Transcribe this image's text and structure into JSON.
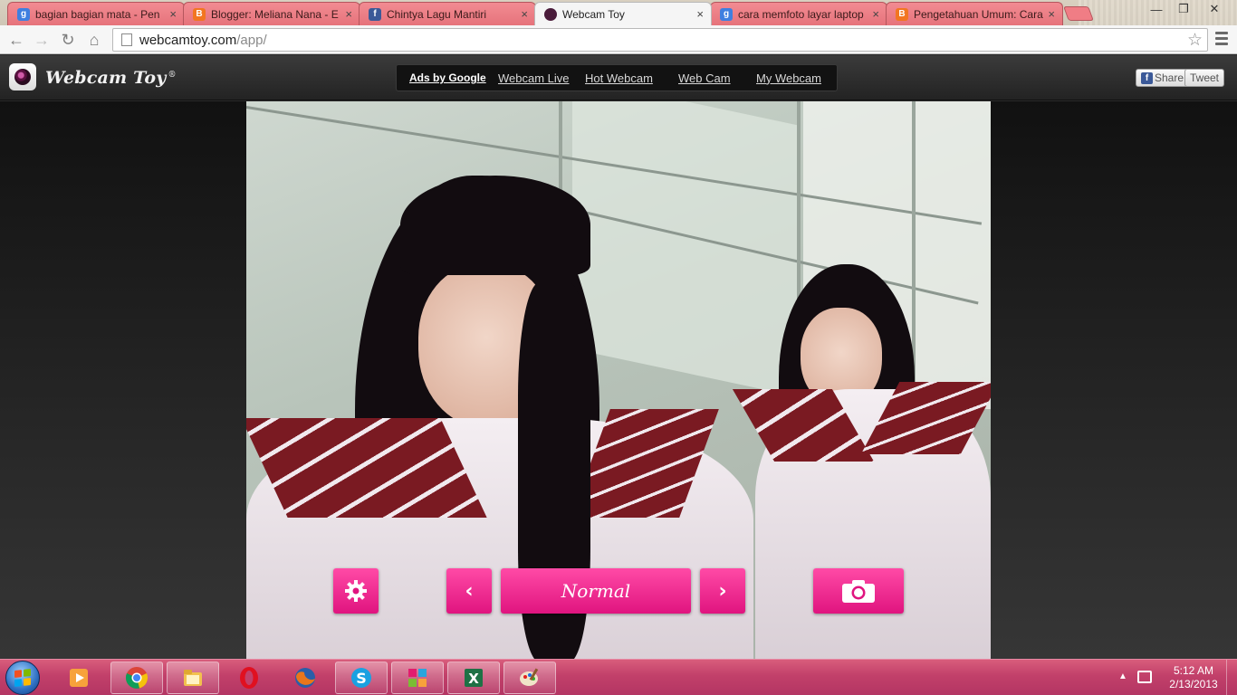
{
  "browser": {
    "tabs": [
      {
        "title": "bagian bagian mata - Pen",
        "favicon": "google-icon",
        "active": false
      },
      {
        "title": "Blogger: Meliana Nana - E",
        "favicon": "blogger-icon",
        "active": false
      },
      {
        "title": "Chintya Lagu Mantiri",
        "favicon": "facebook-icon",
        "active": false
      },
      {
        "title": "Webcam Toy",
        "favicon": "webcamtoy-icon",
        "active": true
      },
      {
        "title": "cara memfoto layar laptop",
        "favicon": "google-icon",
        "active": false
      },
      {
        "title": "Pengetahuan Umum: Cara",
        "favicon": "blogger-icon",
        "active": false
      }
    ],
    "tab_close_glyph": "×",
    "url_host": "webcamtoy.com",
    "url_path": "/app/"
  },
  "site": {
    "title": "Webcam Toy",
    "registered_mark": "®",
    "ad_links": [
      "Ads by Google",
      "Webcam Live",
      "Hot Webcam",
      "Web Cam",
      "My Webcam"
    ],
    "share_label": "Share",
    "tweet_label": "Tweet"
  },
  "controls": {
    "effect_name": "Normal",
    "prev_glyph": "‹",
    "next_glyph": "›"
  },
  "taskbar": {
    "apps": [
      "media-player-icon",
      "chrome-icon",
      "file-explorer-icon",
      "opera-icon",
      "firefox-icon",
      "skype-icon",
      "photo-gallery-icon",
      "excel-icon",
      "paint-icon"
    ],
    "time": "5:12 AM",
    "date": "2/13/2013"
  },
  "colors": {
    "accent_pink": "#e0147f",
    "inactive_tab": "#e6737b",
    "taskbar": "#c2406a"
  }
}
